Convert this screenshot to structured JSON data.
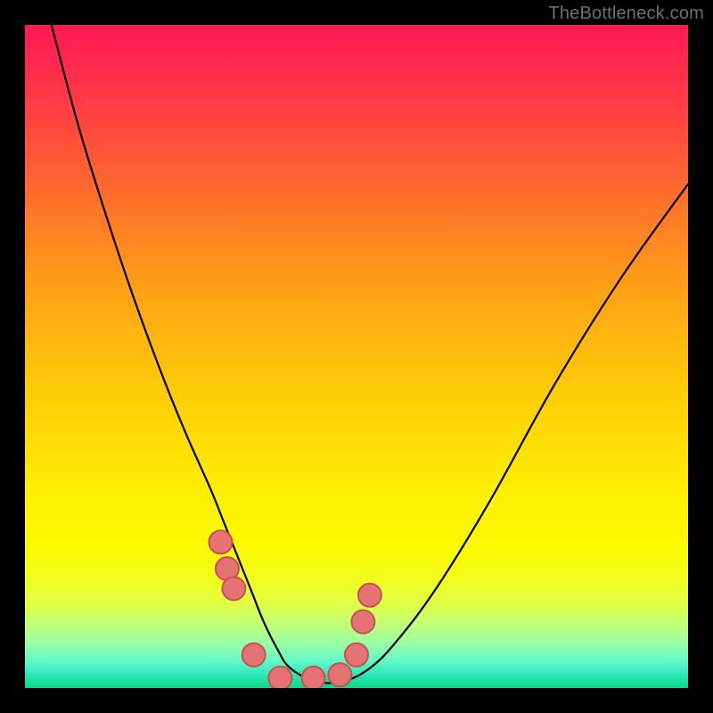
{
  "watermark": "TheBottleneck.com",
  "colors": {
    "frame": "#000000",
    "curve": "#000000",
    "point_fill": "#e57373",
    "point_stroke": "#c6514f",
    "gradient_top": "#ff1a52",
    "gradient_bottom": "#08d884"
  },
  "chart_data": {
    "type": "line",
    "title": "",
    "xlabel": "",
    "ylabel": "",
    "xlim": [
      0,
      100
    ],
    "ylim": [
      0,
      100
    ],
    "grid": false,
    "legend": false,
    "series": [
      {
        "name": "curve",
        "x": [
          4,
          8,
          12,
          16,
          20,
          24,
          28,
          30,
          32,
          34,
          36,
          38,
          40,
          44,
          48,
          52,
          56,
          62,
          70,
          80,
          90,
          100
        ],
        "y": [
          100,
          85,
          72,
          60,
          49,
          39,
          30,
          25,
          20,
          15,
          10,
          6,
          3,
          1,
          1,
          3,
          7,
          15,
          28,
          46,
          62,
          76
        ]
      }
    ],
    "points": {
      "name": "markers",
      "x": [
        29.5,
        30.5,
        31.5,
        34.5,
        38.5,
        43.5,
        47.5,
        50.0,
        51.0,
        52.0
      ],
      "y": [
        22,
        18,
        15,
        5,
        1.5,
        1.5,
        2,
        5,
        10,
        14
      ]
    }
  }
}
